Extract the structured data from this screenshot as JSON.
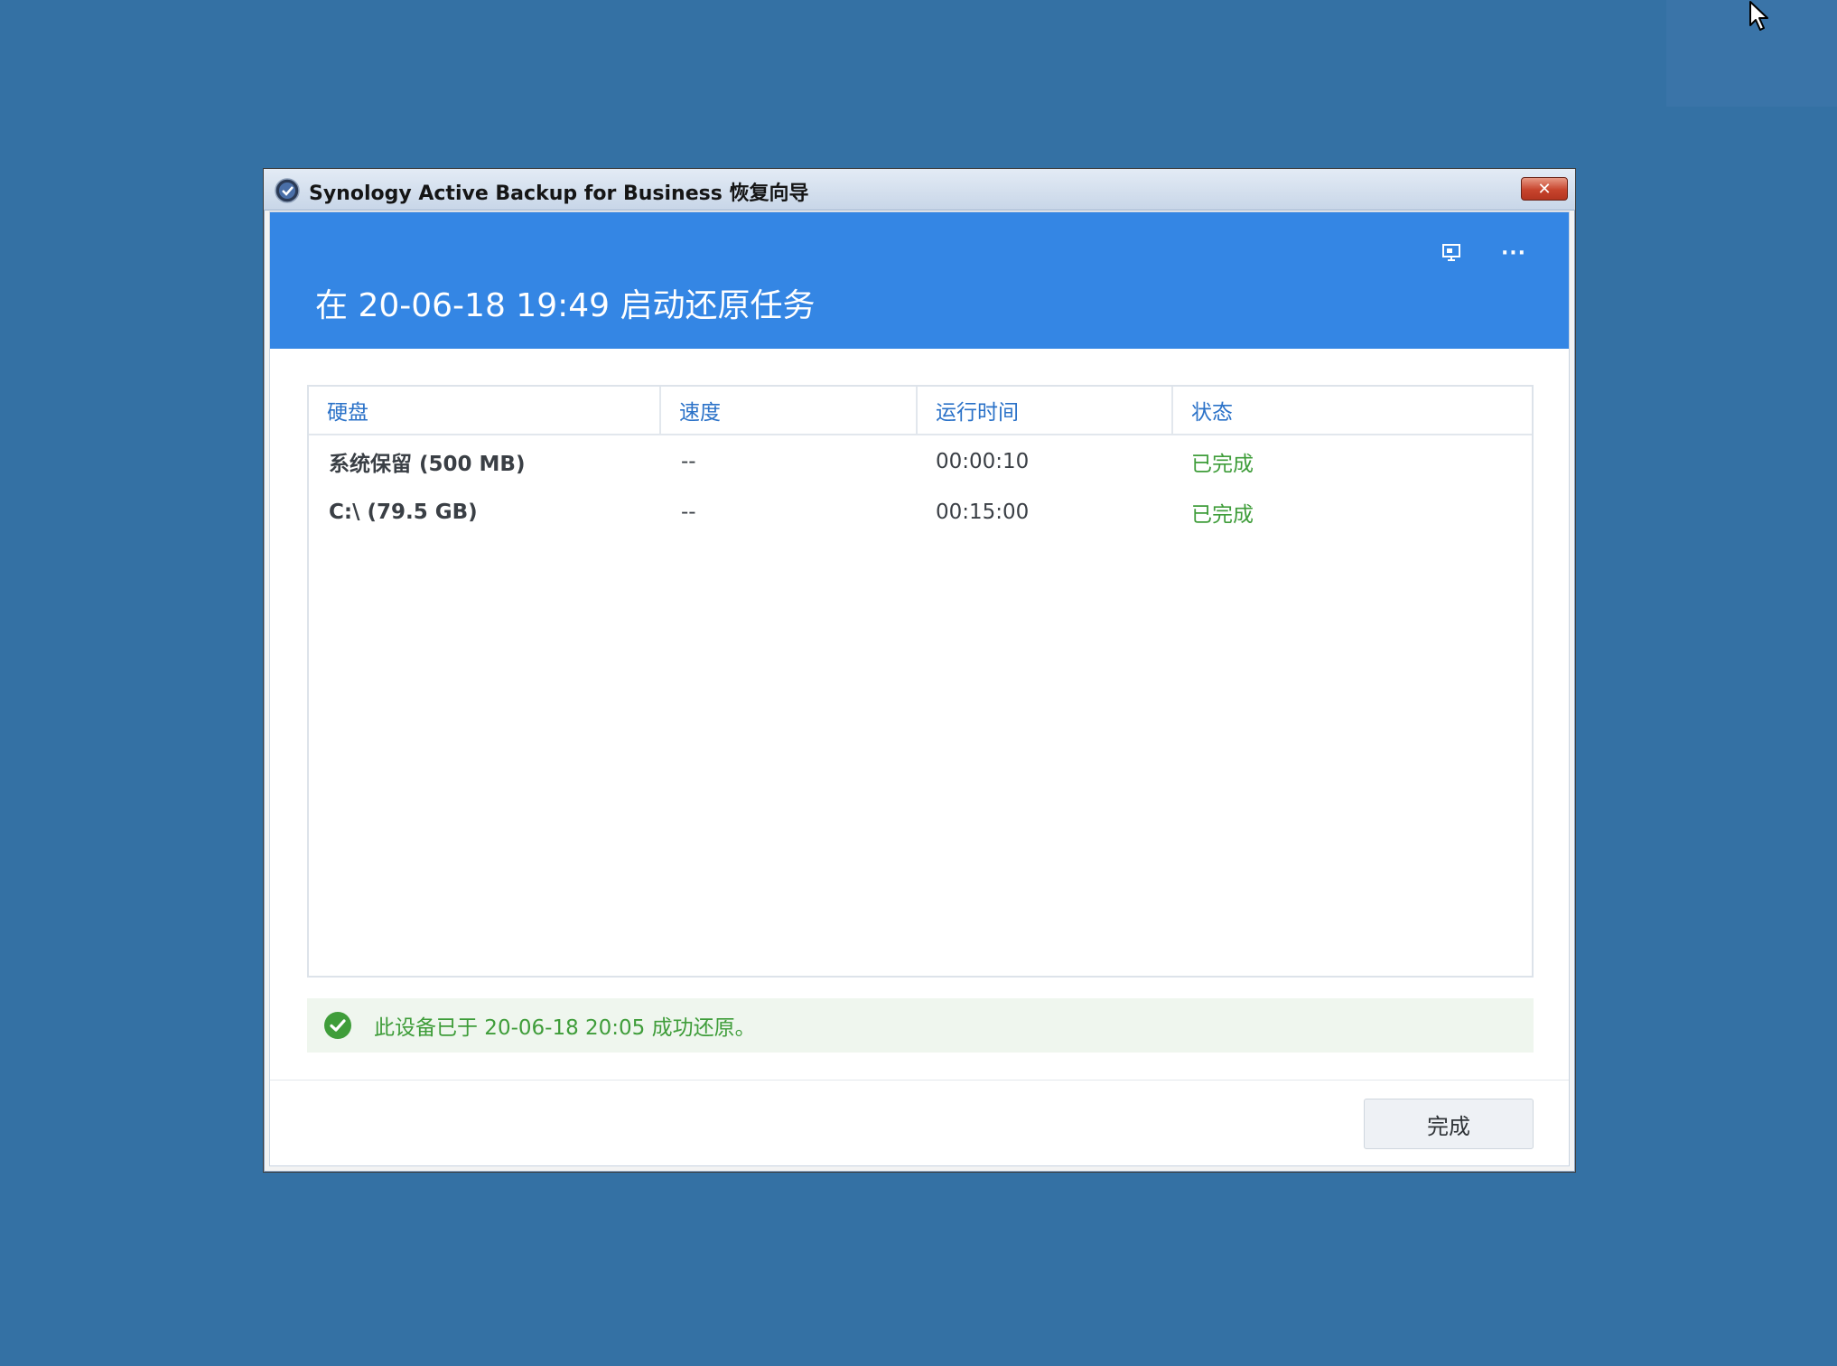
{
  "window": {
    "title": "Synology Active Backup for Business 恢复向导",
    "close_label": "✕"
  },
  "header": {
    "title": "在 20-06-18 19:49 启动还原任务",
    "icons": [
      "monitor-icon",
      "more-icon"
    ],
    "more_label": "···"
  },
  "table": {
    "columns": [
      "硬盘",
      "速度",
      "运行时间",
      "状态"
    ],
    "rows": [
      {
        "disk": "系统保留 (500 MB)",
        "speed": "--",
        "runtime": "00:00:10",
        "status": "已完成"
      },
      {
        "disk": "C:\\ (79.5 GB)",
        "speed": "--",
        "runtime": "00:15:00",
        "status": "已完成"
      }
    ]
  },
  "message": {
    "text": "此设备已于 20-06-18 20:05 成功还原。"
  },
  "footer": {
    "done_label": "完成"
  },
  "colors": {
    "desktop": "#3471a4",
    "header": "#3486e4",
    "success": "#3f9d3a",
    "column_header": "#2b72c8"
  }
}
